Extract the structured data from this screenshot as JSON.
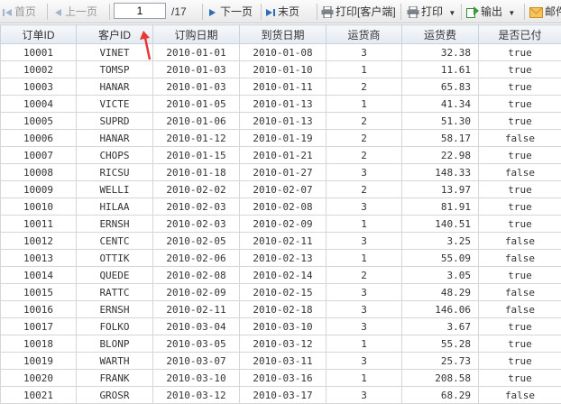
{
  "toolbar": {
    "first": "首页",
    "prev": "上一页",
    "page_value": "1",
    "total": "/17",
    "next": "下一页",
    "last": "末页",
    "print_client": "打印[客户端]",
    "print": "打印",
    "export": "输出",
    "mail": "邮件"
  },
  "grid": {
    "columns": [
      "订单ID",
      "客户ID",
      "订购日期",
      "到货日期",
      "运货商",
      "运货费",
      "是否已付"
    ],
    "rows": [
      [
        "10001",
        "VINET",
        "2010-01-01",
        "2010-01-08",
        "3",
        "32.38",
        "true"
      ],
      [
        "10002",
        "TOMSP",
        "2010-01-03",
        "2010-01-10",
        "1",
        "11.61",
        "true"
      ],
      [
        "10003",
        "HANAR",
        "2010-01-03",
        "2010-01-11",
        "2",
        "65.83",
        "true"
      ],
      [
        "10004",
        "VICTE",
        "2010-01-05",
        "2010-01-13",
        "1",
        "41.34",
        "true"
      ],
      [
        "10005",
        "SUPRD",
        "2010-01-06",
        "2010-01-13",
        "2",
        "51.30",
        "true"
      ],
      [
        "10006",
        "HANAR",
        "2010-01-12",
        "2010-01-19",
        "2",
        "58.17",
        "false"
      ],
      [
        "10007",
        "CHOPS",
        "2010-01-15",
        "2010-01-21",
        "2",
        "22.98",
        "true"
      ],
      [
        "10008",
        "RICSU",
        "2010-01-18",
        "2010-01-27",
        "3",
        "148.33",
        "false"
      ],
      [
        "10009",
        "WELLI",
        "2010-02-02",
        "2010-02-07",
        "2",
        "13.97",
        "true"
      ],
      [
        "10010",
        "HILAA",
        "2010-02-03",
        "2010-02-08",
        "3",
        "81.91",
        "true"
      ],
      [
        "10011",
        "ERNSH",
        "2010-02-03",
        "2010-02-09",
        "1",
        "140.51",
        "true"
      ],
      [
        "10012",
        "CENTC",
        "2010-02-05",
        "2010-02-11",
        "3",
        "3.25",
        "false"
      ],
      [
        "10013",
        "OTTIK",
        "2010-02-06",
        "2010-02-13",
        "1",
        "55.09",
        "false"
      ],
      [
        "10014",
        "QUEDE",
        "2010-02-08",
        "2010-02-14",
        "2",
        "3.05",
        "true"
      ],
      [
        "10015",
        "RATTC",
        "2010-02-09",
        "2010-02-15",
        "3",
        "48.29",
        "false"
      ],
      [
        "10016",
        "ERNSH",
        "2010-02-11",
        "2010-02-18",
        "3",
        "146.06",
        "false"
      ],
      [
        "10017",
        "FOLKO",
        "2010-03-04",
        "2010-03-10",
        "3",
        "3.67",
        "true"
      ],
      [
        "10018",
        "BLONP",
        "2010-03-05",
        "2010-03-12",
        "1",
        "55.28",
        "true"
      ],
      [
        "10019",
        "WARTH",
        "2010-03-07",
        "2010-03-11",
        "3",
        "25.73",
        "true"
      ],
      [
        "10020",
        "FRANK",
        "2010-03-10",
        "2010-03-16",
        "1",
        "208.58",
        "true"
      ],
      [
        "10021",
        "GROSR",
        "2010-03-12",
        "2010-03-17",
        "3",
        "68.29",
        "false"
      ]
    ]
  },
  "icons": {
    "first": "first-page-icon",
    "prev": "prev-page-icon",
    "next": "next-page-icon",
    "last": "last-page-icon",
    "print_client": "printer-icon",
    "print": "printer-icon",
    "export": "export-icon",
    "mail": "envelope-icon"
  },
  "colors": {
    "nav_arrow": "#2a6fb6",
    "disabled": "#9a9a9a",
    "header_bg": "#e8eef5",
    "annotation_arrow": "#e53935"
  }
}
